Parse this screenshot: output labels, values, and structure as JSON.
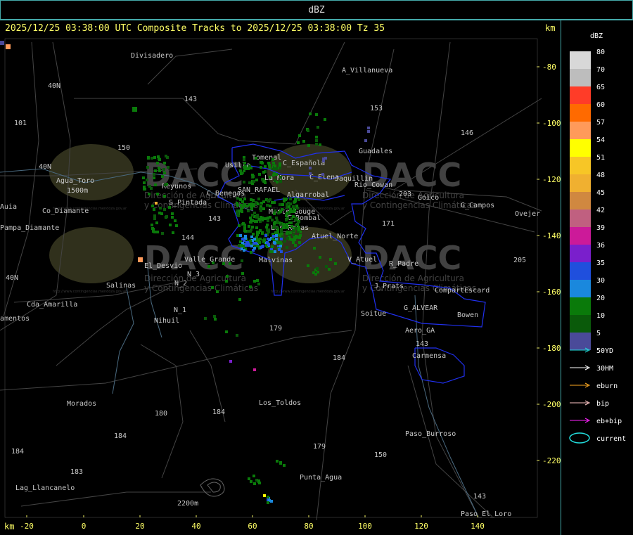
{
  "window": {
    "title": "dBZ",
    "header": "2025/12/25 03:38:00 UTC Composite Tracks to 2025/12/25 03:38:00 Tz 35",
    "km_label": "km"
  },
  "axes": {
    "x_ticks": [
      "-20",
      "0",
      "20",
      "40",
      "60",
      "80",
      "100",
      "120",
      "140"
    ],
    "y_ticks": [
      "-80",
      "-100",
      "-120",
      "-140",
      "-160",
      "-180",
      "-200",
      "-220"
    ]
  },
  "places": [
    {
      "label": "Divisadero"
    },
    {
      "label": "A_Villanueva"
    },
    {
      "label": "40N"
    },
    {
      "label": "101"
    },
    {
      "label": "153"
    },
    {
      "label": "143"
    },
    {
      "label": "150"
    },
    {
      "label": "146"
    },
    {
      "label": "Guadales"
    },
    {
      "label": "40N"
    },
    {
      "label": "Usilla"
    },
    {
      "label": "Tomenal"
    },
    {
      "label": "C_Española"
    },
    {
      "label": "Agua_Toro"
    },
    {
      "label": "1500m"
    },
    {
      "label": "Co_Diamante"
    },
    {
      "label": "Reyunos"
    },
    {
      "label": "La_Mora"
    },
    {
      "label": "C_Elena"
    },
    {
      "label": "Jaquillin"
    },
    {
      "label": "Rio_Cowan"
    },
    {
      "label": "C_Benegas"
    },
    {
      "label": "SAN_RAFAEL"
    },
    {
      "label": "Algarrobal"
    },
    {
      "label": "Goico"
    },
    {
      "label": "G_Campos"
    },
    {
      "label": "Auia"
    },
    {
      "label": "S_Pintada"
    },
    {
      "label": "C_Bombal"
    },
    {
      "label": "Ovejer"
    },
    {
      "label": "Pampa_Diamante"
    },
    {
      "label": "Monte_Gouge"
    },
    {
      "label": "171"
    },
    {
      "label": "Las_Rosas"
    },
    {
      "label": "Atuel_Norte"
    },
    {
      "label": "144"
    },
    {
      "label": "El_Desvio"
    },
    {
      "label": "Valle_Grande"
    },
    {
      "label": "Malvinas"
    },
    {
      "label": "V_Atuel"
    },
    {
      "label": "R_Padre"
    },
    {
      "label": "205"
    },
    {
      "label": "Salinas"
    },
    {
      "label": "N_2"
    },
    {
      "label": "J_Prats"
    },
    {
      "label": "CompartEscard"
    },
    {
      "label": "Cda_Amarilla"
    },
    {
      "label": "N_1"
    },
    {
      "label": "G_ALVEAR"
    },
    {
      "label": "Bowen"
    },
    {
      "label": "amentos"
    },
    {
      "label": "Nihuil"
    },
    {
      "label": "Soitue"
    },
    {
      "label": "Aero_GA"
    },
    {
      "label": "179"
    },
    {
      "label": "143"
    },
    {
      "label": "184"
    },
    {
      "label": "Carmensa"
    },
    {
      "label": "Morados"
    },
    {
      "label": "Los_Toldos"
    },
    {
      "label": "180"
    },
    {
      "label": "184"
    },
    {
      "label": "184"
    },
    {
      "label": "Paso_Burroso"
    },
    {
      "label": "184"
    },
    {
      "label": "179"
    },
    {
      "label": "150"
    },
    {
      "label": "183"
    },
    {
      "label": "Punta_Agua"
    },
    {
      "label": "Lag_Llancanelo"
    },
    {
      "label": "2200m"
    },
    {
      "label": "143"
    },
    {
      "label": "Paso_El_Loro"
    },
    {
      "label": "203"
    },
    {
      "label": "N_3"
    },
    {
      "label": "40N"
    },
    {
      "label": "143"
    }
  ],
  "watermark": {
    "brand": "DACC",
    "line1": "Dirección de Agricultura",
    "line2": "y Contingencias Climáticas",
    "url": "http://www.contingencias.mendoza.gov.ar"
  },
  "legend": {
    "title": "dBZ",
    "levels": [
      {
        "label": "80",
        "color": "#d8d8d8"
      },
      {
        "label": "70",
        "color": "#bdbdbd"
      },
      {
        "label": "65",
        "color": "#ff3c28"
      },
      {
        "label": "60",
        "color": "#ff6a00"
      },
      {
        "label": "57",
        "color": "#ff9a5a"
      },
      {
        "label": "54",
        "color": "#ffff00"
      },
      {
        "label": "51",
        "color": "#f7c626"
      },
      {
        "label": "48",
        "color": "#f0b030"
      },
      {
        "label": "45",
        "color": "#d08840"
      },
      {
        "label": "42",
        "color": "#c06080"
      },
      {
        "label": "39",
        "color": "#cc1a99"
      },
      {
        "label": "36",
        "color": "#7a1fcc"
      },
      {
        "label": "35",
        "color": "#1f4fdd"
      },
      {
        "label": "30",
        "color": "#1a88dd"
      },
      {
        "label": "20",
        "color": "#0a7a0a"
      },
      {
        "label": "10",
        "color": "#0a5a0a"
      },
      {
        "label": "5",
        "color": "#4a4a99"
      }
    ]
  },
  "tracks": [
    {
      "label": "50YD",
      "color": "#22dddd"
    },
    {
      "label": "30HM",
      "color": "#ffffff"
    },
    {
      "label": "eburn",
      "color": "#ffaa22"
    },
    {
      "label": "bip",
      "color": "#ffc8c8"
    },
    {
      "label": "eb+bip",
      "color": "#ff22ff"
    },
    {
      "label": "current",
      "color": "#22dddd"
    }
  ]
}
